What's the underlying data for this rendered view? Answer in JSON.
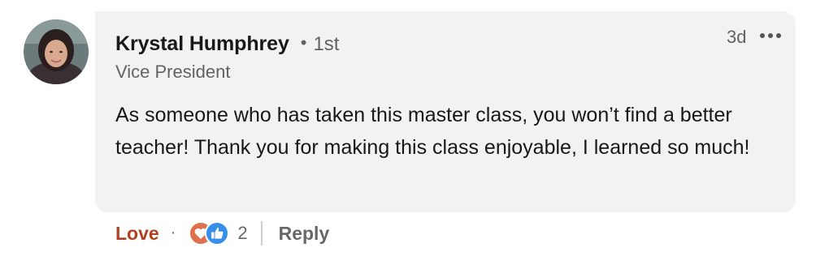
{
  "comment": {
    "author": {
      "name": "Krystal Humphrey",
      "connection_separator": "•",
      "connection_degree": "1st",
      "headline": "Vice President"
    },
    "timestamp": "3d",
    "text": "As someone who has taken this master class, you won’t find a better teacher! Thank you for making this class enjoyable, I learned so much!"
  },
  "actions": {
    "love_label": "Love",
    "separator": "·",
    "reaction_icons": [
      "love-reaction-icon",
      "like-reaction-icon"
    ],
    "reaction_count": "2",
    "reply_label": "Reply"
  },
  "colors": {
    "bubble_bg": "#f2f2f2",
    "love_accent": "#b24020",
    "like_blue": "#378fe9",
    "love_red": "#df704d"
  }
}
